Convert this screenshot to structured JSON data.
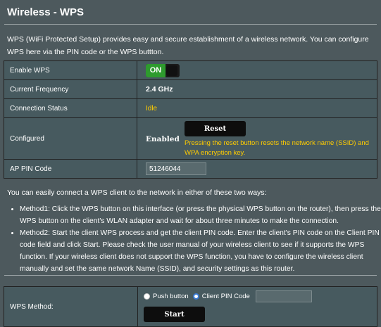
{
  "header": {
    "title": "Wireless - WPS"
  },
  "description": "WPS (WiFi Protected Setup) provides easy and secure establishment of a wireless network. You can configure WPS here via the PIN code or the WPS buttton.",
  "settings": {
    "enable_wps": {
      "label": "Enable WPS",
      "toggle_text": "ON"
    },
    "current_frequency": {
      "label": "Current Frequency",
      "value": "2.4 GHz"
    },
    "connection_status": {
      "label": "Connection Status",
      "value": "Idle"
    },
    "configured": {
      "label": "Configured",
      "value": "Enabled",
      "reset_button": "Reset",
      "reset_hint": "Pressing the reset button resets the network name (SSID) and WPA encryption key."
    },
    "ap_pin": {
      "label": "AP PIN Code",
      "value": "51246044"
    }
  },
  "ways_intro": "You can easily connect a WPS client to the network in either of these two ways:",
  "methods": [
    "Method1: Click the WPS button on this interface (or press the physical WPS button on the router), then press the WPS button on the client's WLAN adapter and wait for about three minutes to make the connection.",
    "Method2: Start the client WPS process and get the client PIN code. Enter the client's PIN code on the Client PIN code field and click Start. Please check the user manual of your wireless client to see if it supports the WPS function. If your wireless client does not support the WPS function, you have to configure the wireless client manually and set the same network Name (SSID), and security settings as this router."
  ],
  "wps_method": {
    "label": "WPS Method:",
    "option_push": "Push button",
    "option_pin": "Client PIN Code",
    "selected": "Client PIN Code",
    "start_button": "Start"
  },
  "colors": {
    "background": "#4d595d",
    "cell": "#475a5f",
    "accent_yellow": "#ffcc00",
    "toggle_green": "#2e9b2e"
  }
}
